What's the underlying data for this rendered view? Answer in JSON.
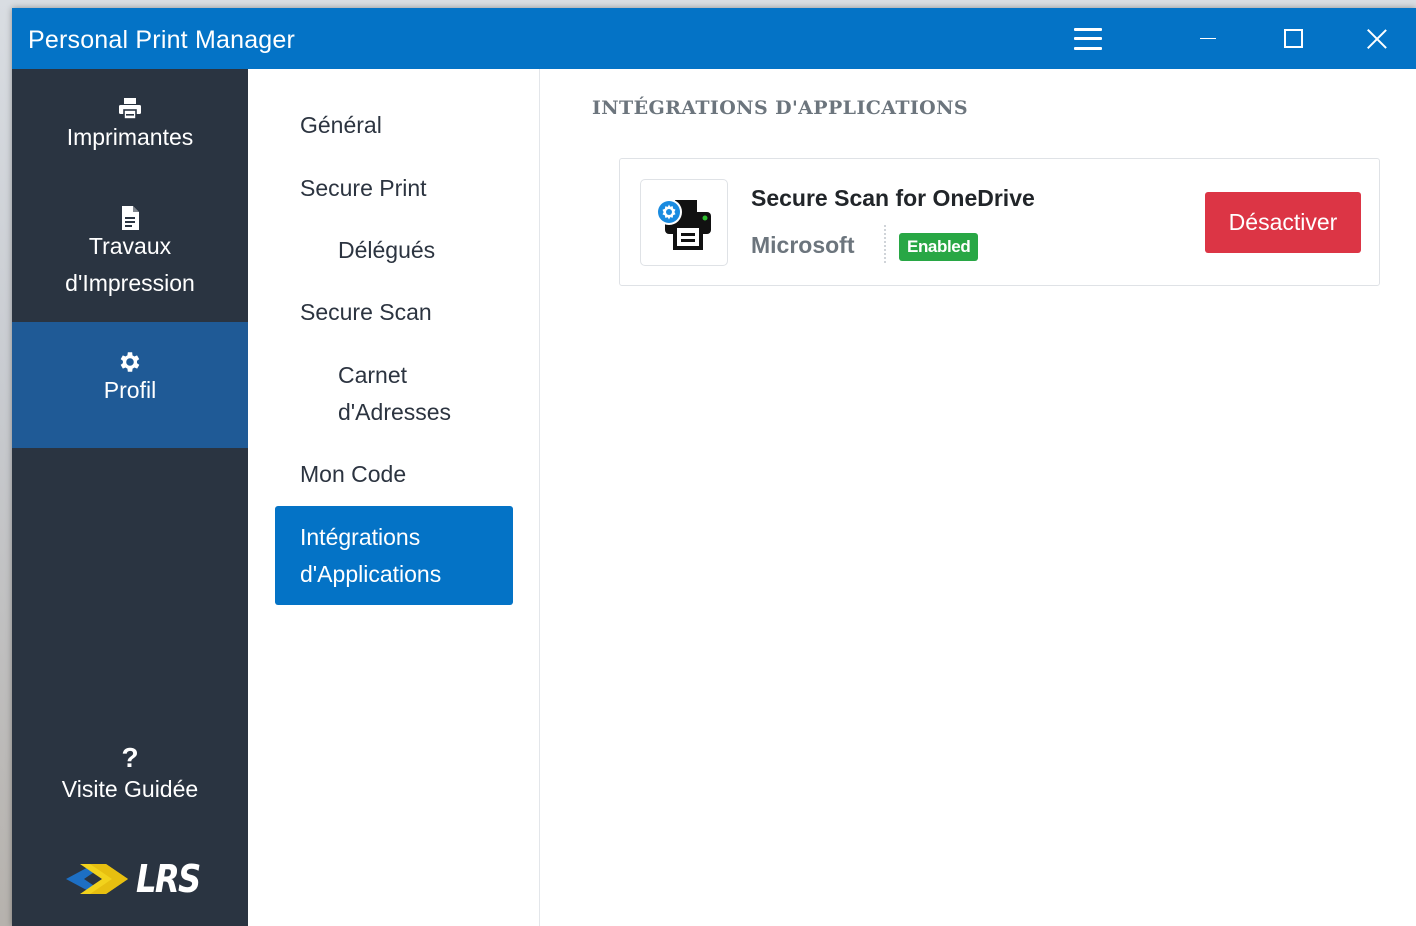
{
  "window": {
    "title": "Personal Print Manager"
  },
  "sidebar": {
    "items": [
      {
        "label": "Imprimantes",
        "icon": "printer-icon"
      },
      {
        "label_line1": "Travaux",
        "label_line2": "d'Impression",
        "icon": "document-icon"
      },
      {
        "label": "Profil",
        "icon": "gear-icon",
        "active": true
      }
    ],
    "tour": {
      "glyph": "?",
      "label": "Visite Guidée"
    },
    "logo_text": "LRS"
  },
  "subnav": {
    "items": [
      {
        "label": "Général"
      },
      {
        "label": "Secure Print"
      },
      {
        "label": "Délégués"
      },
      {
        "label": "Secure Scan"
      },
      {
        "label_line1": "Carnet",
        "label_line2": "d'Adresses"
      },
      {
        "label": "Mon Code"
      },
      {
        "label_line1": "Intégrations",
        "label_line2": "d'Applications",
        "active": true
      }
    ]
  },
  "content": {
    "section_title": "INTÉGRATIONS D'APPLICATIONS",
    "integration": {
      "name": "Secure Scan for OneDrive",
      "vendor": "Microsoft",
      "status": "Enabled",
      "action_label": "Désactiver",
      "icon": "scan-printer-icon"
    }
  },
  "colors": {
    "accent": "#0473c6",
    "sidebar_bg": "#2a3441",
    "sidebar_active": "#1f5a96",
    "danger": "#dc3545",
    "success": "#28a745"
  }
}
